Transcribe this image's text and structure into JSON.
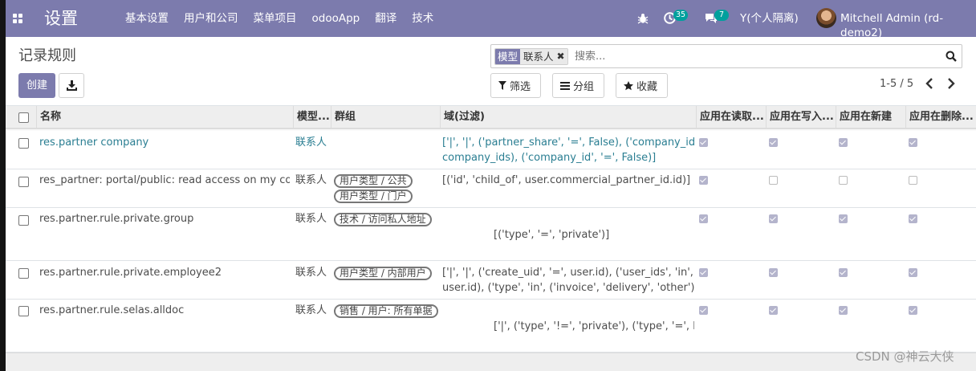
{
  "navbar": {
    "app_title": "设置",
    "menu": [
      "基本设置",
      "用户和公司",
      "菜单项目",
      "odooApp",
      "翻译",
      "技术"
    ],
    "activity_count": "35",
    "message_count": "7",
    "company": "Y(个人隔离)",
    "user": "Mitchell Admin (rd-demo2)"
  },
  "control_panel": {
    "breadcrumb": "记录规则",
    "create_label": "创建",
    "search": {
      "facet_key": "模型",
      "facet_value": "联系人",
      "placeholder": "搜索..."
    },
    "filters_label": "筛选",
    "groupby_label": "分组",
    "favorites_label": "收藏",
    "pager": "1-5 / 5"
  },
  "table": {
    "headers": [
      "名称",
      "模型...",
      "群组",
      "域(过滤)",
      "应用在读取...",
      "应用在写入...",
      "应用在新建",
      "应用在删除..."
    ],
    "rows": [
      {
        "name": "res.partner company",
        "model": "联系人",
        "groups": [],
        "domain": [
          "['|', '|', ('partner_share', '=', False), ('company_id', 'in',",
          "company_ids), ('company_id', '=', False)]"
        ],
        "perm": [
          true,
          true,
          true,
          true
        ]
      },
      {
        "name": "res_partner: portal/public: read access on my com...",
        "model": "联系人",
        "groups": [
          "用户类型 / 公共",
          "用户类型 / 门户"
        ],
        "domain": [
          "[('id', 'child_of', user.commercial_partner_id.id)]"
        ],
        "perm": [
          true,
          false,
          false,
          false
        ]
      },
      {
        "name": "res.partner.rule.private.group",
        "model": "联系人",
        "groups": [
          "技术 / 访问私人地址"
        ],
        "domain": [
          "[('type', '=', 'private')]"
        ],
        "perm": [
          true,
          true,
          true,
          true
        ]
      },
      {
        "name": "res.partner.rule.private.employee2",
        "model": "联系人",
        "groups": [
          "用户类型 / 内部用户"
        ],
        "domain": [
          "['|', '|', ('create_uid', '=', user.id), ('user_ids', 'in',",
          "user.id), ('type', 'in', ('invoice', 'delivery', 'other'))]"
        ],
        "perm": [
          true,
          true,
          true,
          true
        ]
      },
      {
        "name": "res.partner.rule.selas.alldoc",
        "model": "联系人",
        "groups": [
          "销售 / 用户: 所有单据"
        ],
        "domain": [
          "['|', ('type', '!=', 'private'), ('type', '=', False)]"
        ],
        "perm": [
          true,
          true,
          true,
          true
        ]
      }
    ]
  },
  "watermark": "CSDN @神云大侠"
}
